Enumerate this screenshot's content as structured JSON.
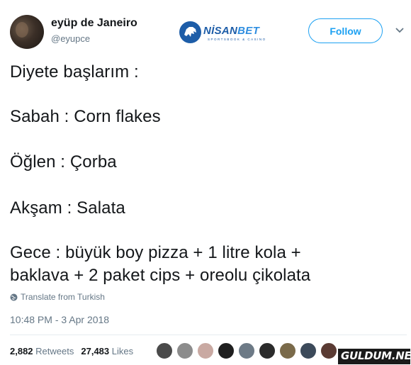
{
  "user": {
    "name": "eyüp de Janeiro",
    "handle": "@eyupce"
  },
  "logo": {
    "brand_main": "NİSAN",
    "brand_accent": "BET",
    "tagline": "SPORTSBOOK & CASINO"
  },
  "follow_label": "Follow",
  "tweet_lines": [
    "Diyete başlarım :",
    "Sabah : Corn flakes",
    "Öğlen : Çorba",
    "Akşam : Salata",
    "Gece : büyük boy pizza + 1 litre kola +",
    "baklava + 2 paket cips + oreolu çikolata"
  ],
  "translate_label": "Translate from Turkish",
  "timestamp": "10:48 PM - 3 Apr 2018",
  "stats": {
    "retweets_count": "2,882",
    "retweets_label": "Retweets",
    "likes_count": "27,483",
    "likes_label": "Likes"
  },
  "likers": [
    {
      "color": "#4a4a4a"
    },
    {
      "color": "#8c8c8c"
    },
    {
      "color": "#c9a9a2"
    },
    {
      "color": "#1f1f1f"
    },
    {
      "color": "#6d7a86"
    },
    {
      "color": "#2b2b2b"
    },
    {
      "color": "#7a6a4a"
    },
    {
      "color": "#3c4a5a"
    },
    {
      "color": "#5a3b33"
    }
  ],
  "watermark": "GULDUM.NET",
  "colors": {
    "accent": "#1da1f2",
    "secondary_text": "#657786",
    "brand_blue": "#1d5da8"
  }
}
